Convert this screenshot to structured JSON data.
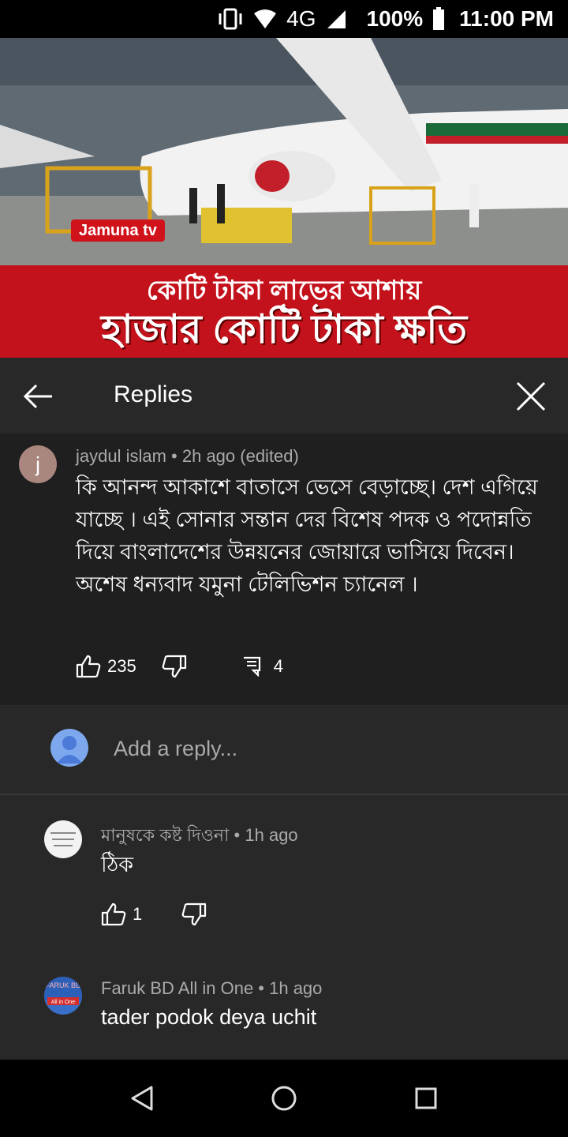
{
  "status_bar": {
    "network": "4G",
    "battery": "100%",
    "time": "11:00 PM"
  },
  "video": {
    "channel_logo": "Jamuna tv",
    "headline_line1": "কোটি টাকা লাভের আশায়",
    "headline_line2": "হাজার কোটি টাকা ক্ষতি"
  },
  "header": {
    "title": "Replies"
  },
  "main_comment": {
    "avatar_letter": "j",
    "meta": "jaydul islam • 2h ago (edited)",
    "text": "কি আনন্দ আকাশে বাতাসে ভেসে বেড়াচ্ছে। দেশ এগিয়ে যাচ্ছে । এই সোনার সন্তান দের বিশেষ পদক ও  পদোন্নতি দিয়ে বাংলাদেশের উন্নয়নের জোয়ারে ভাসিয়ে দিবেন।অশেষ ধন্যবাদ যমুনা টেলিভিশন চ্যানেল ।",
    "likes": "235",
    "replies": "4"
  },
  "reply_box": {
    "placeholder": "Add a reply..."
  },
  "replies": [
    {
      "meta": "মানুষকে কষ্ট দিওনা • 1h ago",
      "text": "ঠিক",
      "likes": "1"
    },
    {
      "meta": "Faruk BD All in One • 1h ago",
      "text": "tader podok deya uchit",
      "avatar_text_top": "FARUK BD",
      "avatar_text_bottom": "All in One"
    }
  ],
  "colors": {
    "panel_bg": "#282828",
    "comment_bg": "#1f1f1f",
    "banner_red": "#c3121b"
  }
}
